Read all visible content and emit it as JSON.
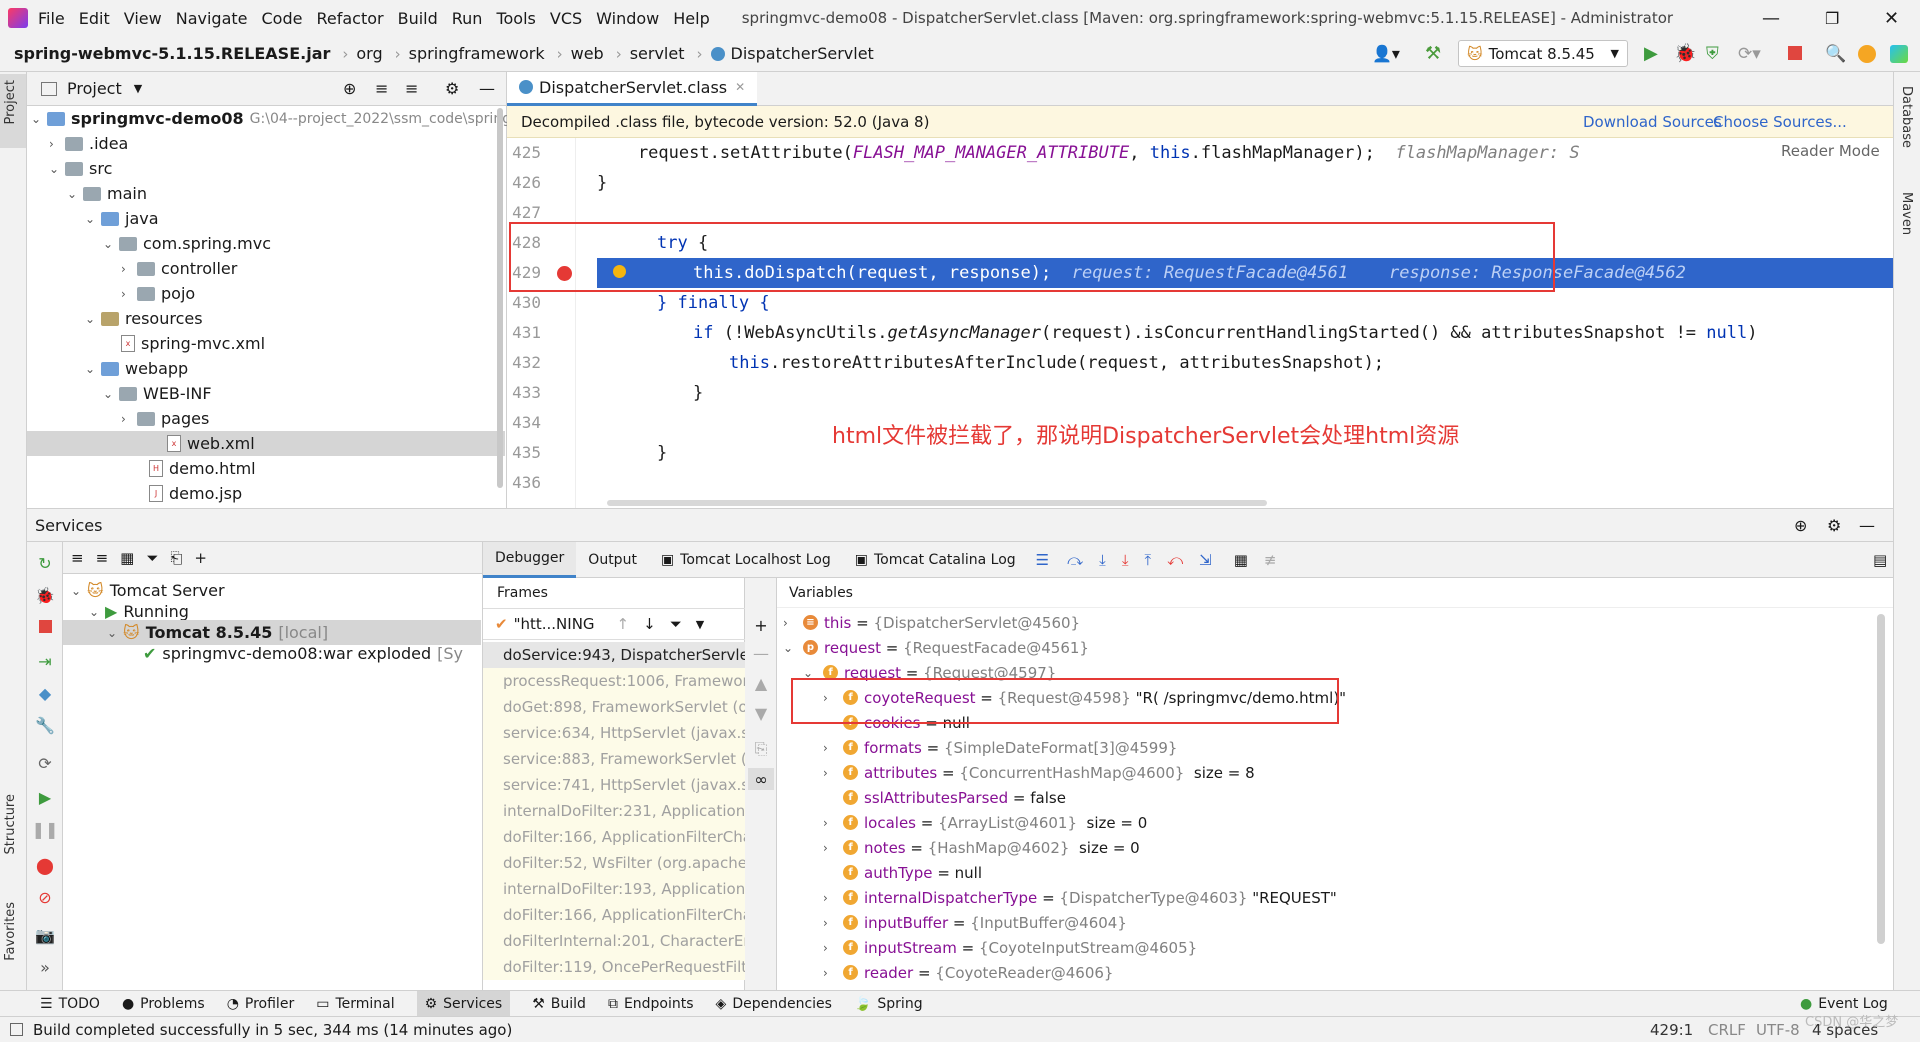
{
  "menu": {
    "items": [
      "File",
      "Edit",
      "View",
      "Navigate",
      "Code",
      "Refactor",
      "Build",
      "Run",
      "Tools",
      "VCS",
      "Window",
      "Help"
    ],
    "window_title": "springmvc-demo08 - DispatcherServlet.class [Maven: org.springframework:spring-webmvc:5.1.15.RELEASE] - Administrator"
  },
  "breadcrumb": [
    "spring-webmvc-5.1.15.RELEASE.jar",
    "org",
    "springframework",
    "web",
    "servlet",
    "DispatcherServlet"
  ],
  "run_config": "Tomcat 8.5.45",
  "left_strip": {
    "project": "Project",
    "structure": "Structure",
    "favorites": "Favorites"
  },
  "right_strip": {
    "database": "Database",
    "maven": "Maven"
  },
  "project_panel": {
    "title": "Project",
    "tree": [
      {
        "label": "springmvc-demo08",
        "extra": "G:\\04--project_2022\\ssm_code\\spring"
      },
      {
        "label": ".idea"
      },
      {
        "label": "src"
      },
      {
        "label": "main"
      },
      {
        "label": "java"
      },
      {
        "label": "com.spring.mvc"
      },
      {
        "label": "controller"
      },
      {
        "label": "pojo"
      },
      {
        "label": "resources"
      },
      {
        "label": "spring-mvc.xml"
      },
      {
        "label": "webapp"
      },
      {
        "label": "WEB-INF"
      },
      {
        "label": "pages"
      },
      {
        "label": "web.xml"
      },
      {
        "label": "demo.html"
      },
      {
        "label": "demo.jsp"
      }
    ]
  },
  "editor": {
    "tab": "DispatcherServlet.class",
    "banner": "Decompiled .class file, bytecode version: 52.0 (Java 8)",
    "download_sources": "Download Sources",
    "choose_sources": "Choose Sources...",
    "reader_mode": "Reader Mode",
    "lines": {
      "n425": "425",
      "n426": "426",
      "n427": "427",
      "n428": "428",
      "n429": "429",
      "n430": "430",
      "n431": "431",
      "n432": "432",
      "n433": "433",
      "n434": "434",
      "n435": "435",
      "n436": "436",
      "l425_pre": "    request.setAttribute(",
      "l425_field": "FLASH_MAP_MANAGER_ATTRIBUTE",
      "l425_mid": ", ",
      "l425_this": "this",
      "l425_post": ".flashMapManager);",
      "l425_hint": "flashMapManager: S",
      "l426": "}",
      "l428_kw": "try",
      "l428_rest": " {",
      "l429_this": "this",
      "l429_code": ".doDispatch(request, response);",
      "l429_hint": "request: RequestFacade@4561    response: ResponseFacade@4562",
      "l430": "} finally {",
      "l431_kw": "if",
      "l431_a": " (!WebAsyncUtils.",
      "l431_m": "getAsyncManager",
      "l431_b": "(request).isConcurrentHandlingStarted() && attributesSnapshot != ",
      "l431_null": "null",
      "l431_c": ")",
      "l432_this": "this",
      "l432_rest": ".restoreAttributesAfterInclude(request, attributesSnapshot);",
      "l433": "}",
      "l435": "}"
    },
    "annotation": "html文件被拦截了，那说明DispatcherServlet会处理html资源"
  },
  "services": {
    "title": "Services",
    "tree": [
      {
        "label": "Tomcat Server"
      },
      {
        "label": "Running"
      },
      {
        "label": "Tomcat 8.5.45",
        "extra": "[local]"
      },
      {
        "label": "springmvc-demo08:war exploded",
        "extra": "[Sy"
      }
    ]
  },
  "debugger": {
    "tabs": [
      "Debugger",
      "Output",
      "Tomcat Localhost Log",
      "Tomcat Catalina Log"
    ],
    "frames_title": "Frames",
    "thread": "\"htt...NING",
    "frames": [
      "doService:943, DispatcherServlet",
      "processRequest:1006, Framewor",
      "doGet:898, FrameworkServlet (or",
      "service:634, HttpServlet (javax.se",
      "service:883, FrameworkServlet (o",
      "service:741, HttpServlet (javax.se",
      "internalDoFilter:231, Application",
      "doFilter:166, ApplicationFilterCha",
      "doFilter:52, WsFilter (org.apache.",
      "internalDoFilter:193, Application",
      "doFilter:166, ApplicationFilterCha",
      "doFilterInternal:201, CharacterEn",
      "doFilter:119, OncePerRequestFilt"
    ],
    "variables_title": "Variables",
    "variables": [
      {
        "name": "this",
        "value": "{DispatcherServlet@4560}",
        "extra": ""
      },
      {
        "name": "request",
        "value": "{RequestFacade@4561}",
        "extra": ""
      },
      {
        "name": "request",
        "value": "{Request@4597}",
        "extra": ""
      },
      {
        "name": "coyoteRequest",
        "value": "{Request@4598}",
        "extra": "\"R( /springmvc/demo.html)\""
      },
      {
        "name": "cookies",
        "value": "null",
        "extra": ""
      },
      {
        "name": "formats",
        "value": "{SimpleDateFormat[3]@4599}",
        "extra": ""
      },
      {
        "name": "attributes",
        "value": "{ConcurrentHashMap@4600}",
        "extra": "size = 8"
      },
      {
        "name": "sslAttributesParsed",
        "value": "false",
        "extra": ""
      },
      {
        "name": "locales",
        "value": "{ArrayList@4601}",
        "extra": "size = 0"
      },
      {
        "name": "notes",
        "value": "{HashMap@4602}",
        "extra": "size = 0"
      },
      {
        "name": "authType",
        "value": "null",
        "extra": ""
      },
      {
        "name": "internalDispatcherType",
        "value": "{DispatcherType@4603}",
        "extra": "\"REQUEST\""
      },
      {
        "name": "inputBuffer",
        "value": "{InputBuffer@4604}",
        "extra": ""
      },
      {
        "name": "inputStream",
        "value": "{CoyoteInputStream@4605}",
        "extra": ""
      },
      {
        "name": "reader",
        "value": "{CoyoteReader@4606}",
        "extra": ""
      }
    ]
  },
  "bottom_tabs": [
    "TODO",
    "Problems",
    "Profiler",
    "Terminal",
    "Services",
    "Build",
    "Endpoints",
    "Dependencies",
    "Spring"
  ],
  "event_log": "Event Log",
  "status": {
    "message": "Build completed successfully in 5 sec, 344 ms (14 minutes ago)",
    "position": "429:1",
    "line_sep": "CRLF",
    "encoding": "UTF-8",
    "indent": "4 spaces",
    "watermark": "CSDN @华之梦"
  },
  "colors": {
    "accent": "#2f65ca",
    "breakpoint": "#e53935",
    "annotation": "#e53935"
  }
}
